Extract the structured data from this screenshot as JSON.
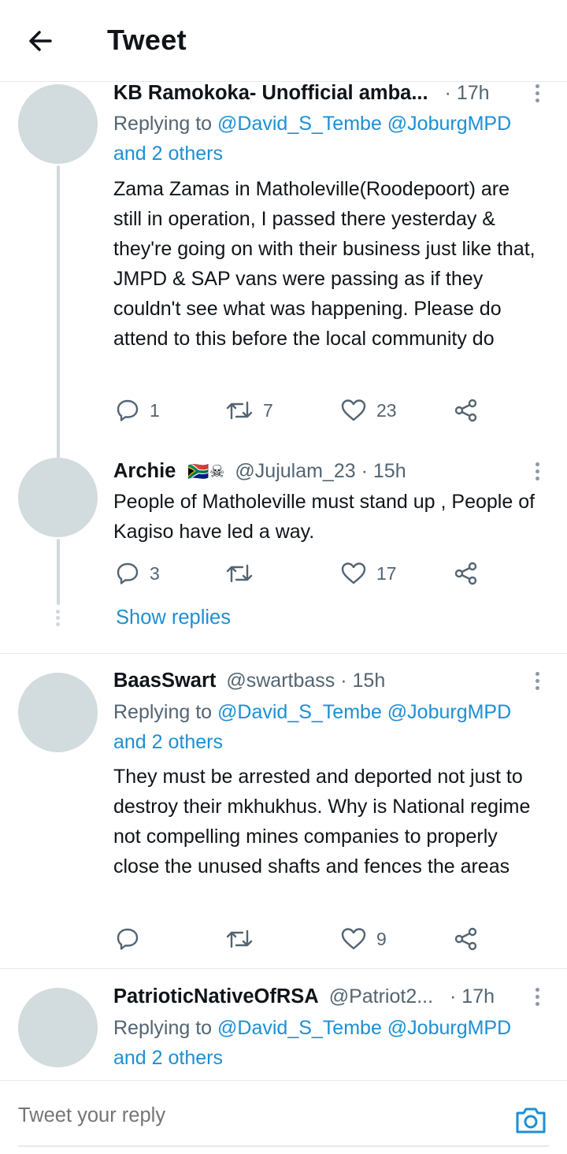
{
  "header": {
    "title": "Tweet"
  },
  "tweets": [
    {
      "name": "KB Ramokoka- Unofficial amba...",
      "handle": "",
      "time": "· 17h",
      "replying_prefix": "Replying to ",
      "replying_handles": "@David_S_Tembe @JoburgMPD",
      "replying_others": "and 2 others",
      "body": "Zama Zamas in Matholeville(Roodepoort) are still in operation, I passed there yesterday & they're going on with their business just like that, JMPD & SAP vans were passing as if they couldn't see what was happening. Please do attend to this before the local community do",
      "replies": "1",
      "retweets": "7",
      "likes": "23"
    },
    {
      "name": "Archie",
      "flags": "🇿🇦☠",
      "handle": "@Jujulam_23",
      "time": "· 15h",
      "body": "People of Matholeville must stand up , People of Kagiso have led a way.",
      "replies": "3",
      "retweets": "",
      "likes": "17",
      "show_replies": "Show replies"
    },
    {
      "name": "BaasSwart",
      "handle": "@swartbass",
      "time": "· 15h",
      "replying_prefix": "Replying to ",
      "replying_handles": "@David_S_Tembe @JoburgMPD",
      "replying_others": "and 2 others",
      "body": "They must be arrested and deported not just to destroy their mkhukhus. Why is National regime not compelling mines companies to properly close the unused shafts and fences the areas",
      "replies": "",
      "retweets": "",
      "likes": "9"
    },
    {
      "name": "PatrioticNativeOfRSA",
      "handle": "@Patriot2...",
      "time": "· 17h",
      "replying_prefix": "Replying to ",
      "replying_handles": "@David_S_Tembe @JoburgMPD",
      "replying_others": "and 2 others"
    }
  ],
  "reply_bar": {
    "placeholder": "Tweet your reply"
  },
  "icons": {
    "back": "arrow-left-icon",
    "more": "more-vertical-icon",
    "reply": "comment-icon",
    "retweet": "retweet-icon",
    "like": "heart-icon",
    "share": "share-icon",
    "camera": "camera-icon"
  },
  "colors": {
    "link": "#1d8fd3",
    "secondary": "#536471",
    "avatar": "#d2dbdd",
    "thread_line": "#cfd9de"
  }
}
